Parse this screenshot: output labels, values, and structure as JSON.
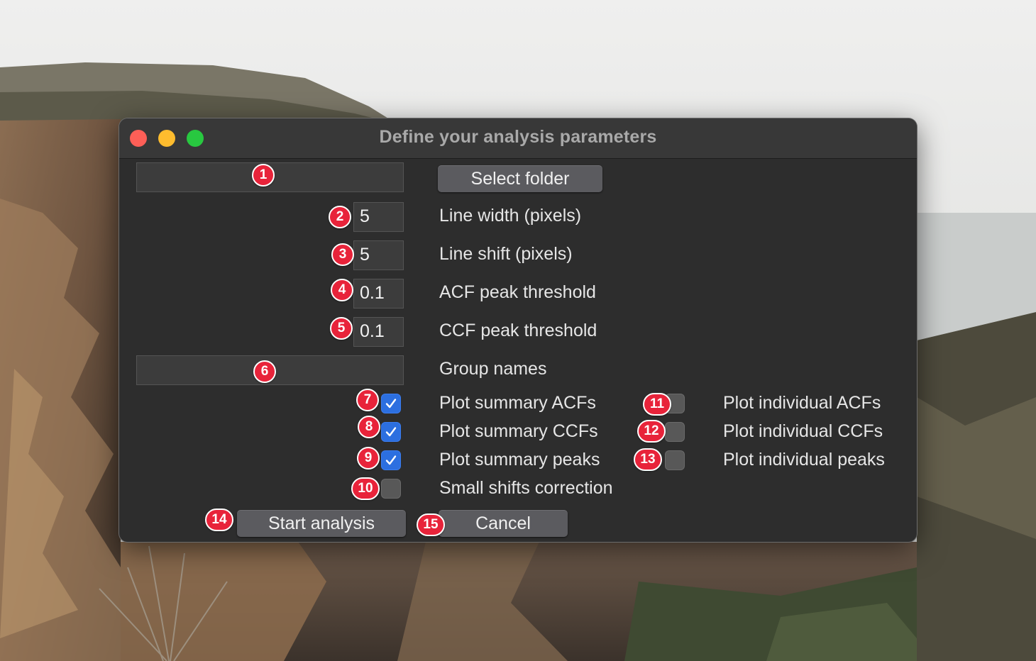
{
  "window": {
    "title": "Define your analysis parameters"
  },
  "form": {
    "folder_field": {
      "value": ""
    },
    "select_folder_label": "Select folder",
    "line_width": {
      "value": "5",
      "label": "Line width (pixels)"
    },
    "line_shift": {
      "value": "5",
      "label": "Line shift (pixels)"
    },
    "acf_threshold": {
      "value": "0.1",
      "label": "ACF peak threshold"
    },
    "ccf_threshold": {
      "value": "0.1",
      "label": "CCF peak threshold"
    },
    "group_names": {
      "value": "",
      "label": "Group names"
    },
    "checkboxes": [
      {
        "label": "Plot summary ACFs",
        "checked": true
      },
      {
        "label": "Plot summary CCFs",
        "checked": true
      },
      {
        "label": "Plot summary peaks",
        "checked": true
      },
      {
        "label": "Small shifts correction",
        "checked": false
      },
      {
        "label": "Plot individual ACFs",
        "checked": false
      },
      {
        "label": "Plot individual CCFs",
        "checked": false
      },
      {
        "label": "Plot individual peaks",
        "checked": false
      }
    ],
    "start_label": "Start analysis",
    "cancel_label": "Cancel"
  },
  "badges": [
    "1",
    "2",
    "3",
    "4",
    "5",
    "6",
    "7",
    "8",
    "9",
    "10",
    "11",
    "12",
    "13",
    "14",
    "15"
  ],
  "colors": {
    "window_bg": "#2d2d2d",
    "badge": "#e8233a",
    "checkbox_checked": "#2c6fe0",
    "button": "#5b5b5f"
  }
}
